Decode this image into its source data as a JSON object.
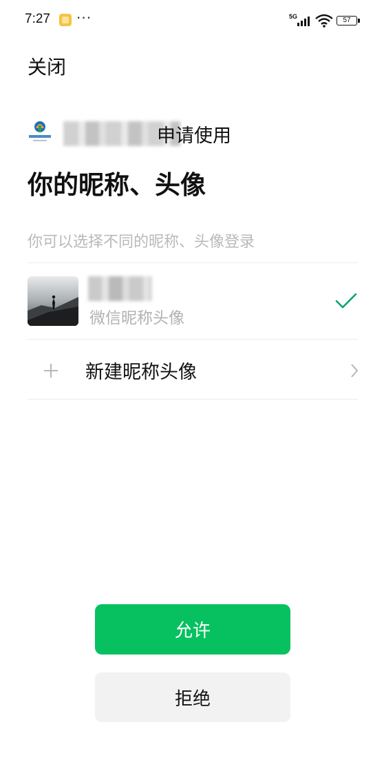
{
  "status_bar": {
    "time": "7:27",
    "more": "···",
    "network": "5G",
    "battery": "57"
  },
  "header": {
    "close_label": "关闭"
  },
  "app": {
    "request_text": "申请使用",
    "logo_icon": "app-logo-icon"
  },
  "permission": {
    "title": "你的昵称、头像",
    "subtitle": "你可以选择不同的昵称、头像登录"
  },
  "options": {
    "wechat_profile": {
      "sub_label": "微信昵称头像",
      "selected": true,
      "check_icon": "checkmark-icon"
    },
    "new_profile": {
      "label": "新建昵称头像",
      "icon": "plus-icon",
      "chevron_icon": "chevron-right-icon"
    }
  },
  "actions": {
    "allow_label": "允许",
    "reject_label": "拒绝"
  },
  "colors": {
    "accent": "#07c160",
    "check": "#0aa36e",
    "reject_bg": "#f2f2f2",
    "subtle_text": "#b2b2b2"
  }
}
